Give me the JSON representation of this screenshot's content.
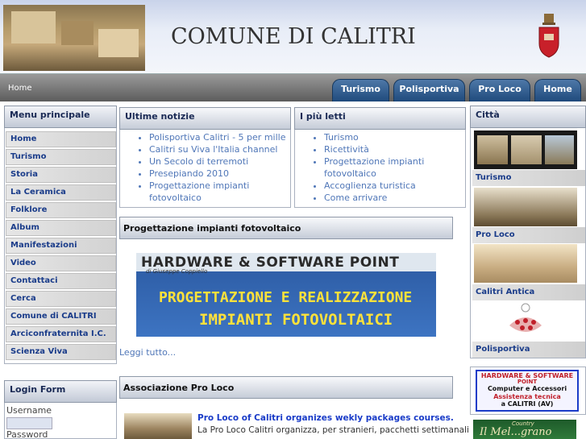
{
  "header": {
    "site_title": "COMUNE DI CALITRI",
    "brand_color": "#1f4a7c"
  },
  "nav": {
    "breadcrumb": "Home",
    "tabs": [
      {
        "label": "Turismo"
      },
      {
        "label": "Polisportiva"
      },
      {
        "label": "Pro Loco"
      },
      {
        "label": "Home"
      }
    ]
  },
  "menu": {
    "title": "Menu principale",
    "items": [
      "Home",
      "Turismo",
      "Storia",
      "La Ceramica",
      "Folklore",
      "Album",
      "Manifestazioni",
      "Video",
      "Contattaci",
      "Cerca",
      "Comune di CALITRI",
      "Arciconfraternita I.C.",
      "Scienza Viva"
    ]
  },
  "login": {
    "title": "Login Form",
    "username_label": "Username",
    "password_label": "Password"
  },
  "news": {
    "title": "Ultime notizie",
    "items": [
      "Polisportiva Calitri - 5 per mille",
      "Calitri su Viva l'Italia channel",
      "Un Secolo di terremoti",
      "Presepiando 2010",
      "Progettazione impianti fotovoltaico"
    ]
  },
  "popular": {
    "title": "I più letti",
    "items": [
      "Turismo",
      "Ricettività",
      "Progettazione impianti fotovoltaico",
      "Accoglienza turistica",
      "Come arrivare"
    ]
  },
  "article1": {
    "title": "Progettazione impianti fotovoltaico",
    "ad_line1": "HARDWARE & SOFTWARE POINT",
    "ad_line2": "di Giuseppe Coppiello",
    "ad_line3": "PROGETTAZIONE E REALIZZAZIONE",
    "ad_line4": "IMPIANTI FOTOVOLTAICI",
    "read_more": "Leggi tutto..."
  },
  "article2": {
    "title": "Associazione Pro Loco",
    "headline": "Pro Loco of Calitri organizes wekly packages courses.",
    "body": "La Pro Loco Calitri organizza, per stranieri, pacchetti settimanali"
  },
  "city": {
    "title": "Città",
    "items": [
      "Turismo",
      "Pro Loco",
      "Calitri Antica",
      "Polisportiva"
    ]
  },
  "side_ad": {
    "line1": "HARDWARE & SOFTWARE",
    "line2": "POINT",
    "line3": "Computer e Accessori",
    "line4": "Assistenza tecnica",
    "line5": "a CALITRI (AV)"
  },
  "side_ad2": {
    "text": "Il Mel...grano",
    "sub": "Country"
  }
}
